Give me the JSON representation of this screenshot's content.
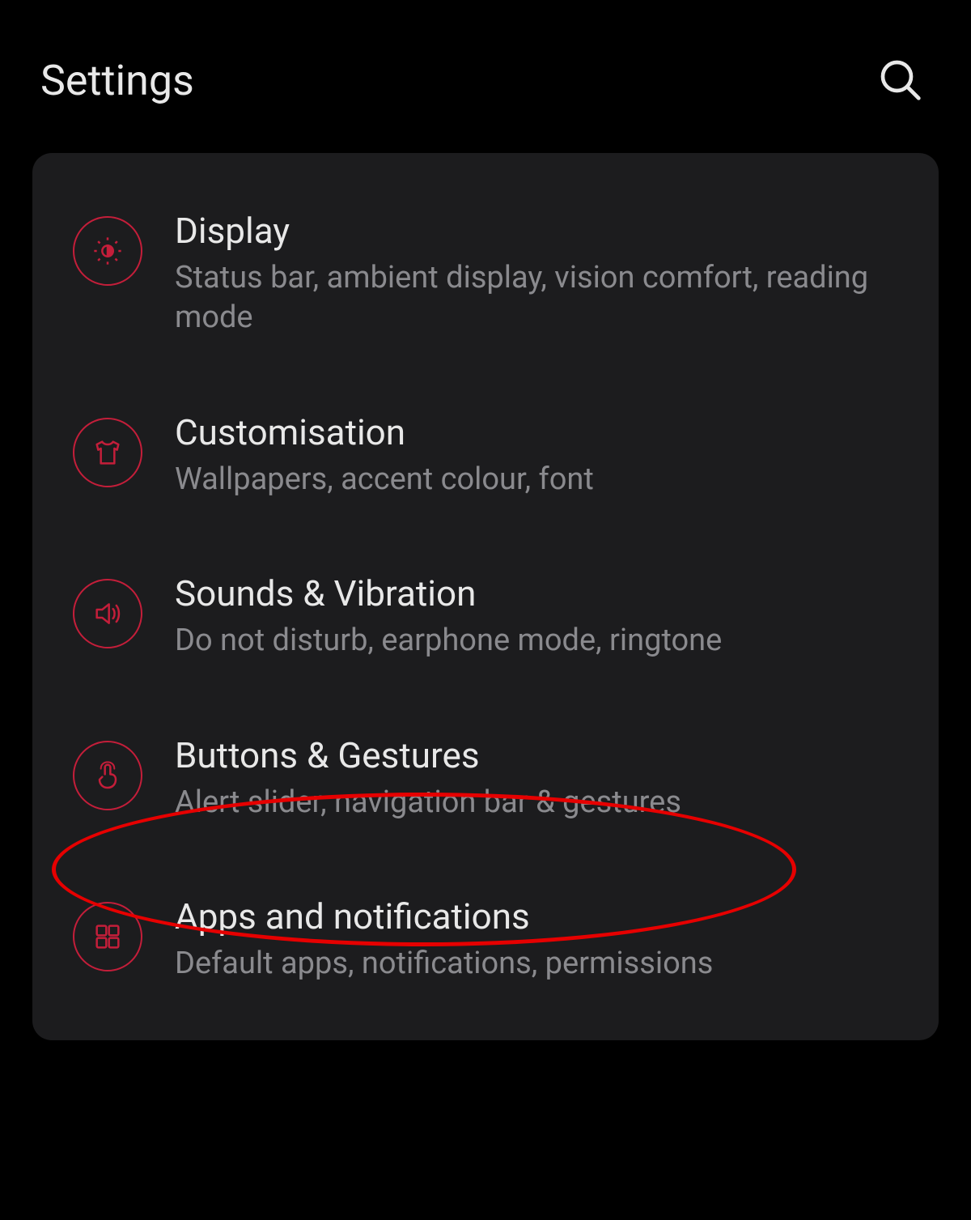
{
  "header": {
    "title": "Settings"
  },
  "settings": {
    "items": [
      {
        "icon": "brightness",
        "title": "Display",
        "subtitle": "Status bar, ambient display, vision comfort, reading mode"
      },
      {
        "icon": "shirt",
        "title": "Customisation",
        "subtitle": "Wallpapers, accent colour, font"
      },
      {
        "icon": "speaker",
        "title": "Sounds & Vibration",
        "subtitle": "Do not disturb, earphone mode, ringtone"
      },
      {
        "icon": "touch",
        "title": "Buttons & Gestures",
        "subtitle": "Alert slider, navigation bar & gestures"
      },
      {
        "icon": "apps",
        "title": "Apps and notifications",
        "subtitle": "Default apps, notifications, permissions"
      }
    ]
  },
  "colors": {
    "accent": "#c41e3a",
    "annotation": "#e60000"
  }
}
